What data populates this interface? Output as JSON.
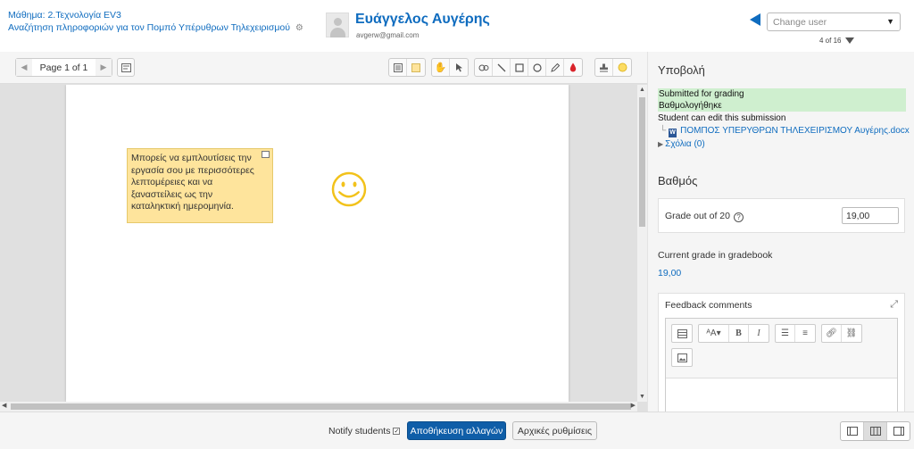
{
  "header": {
    "course_link": "Μάθημα: 2.Τεχνολογία ΕV3",
    "assignment_link": "Αναζήτηση πληροφοριών για τον Πομπό Υπέρυθρων Τηλεχειρισμού",
    "user_name": "Ευάγγελος Αυγέρης",
    "user_email": "avgerw@gmail.com",
    "change_user_placeholder": "Change user",
    "user_count": "4 of 16"
  },
  "viewer": {
    "page_label": "Page 1 of 1",
    "toolbar_icons": [
      "comment-icon",
      "color-swatch-icon",
      "pan-hand-icon",
      "select-arrow-icon",
      "oval-search-icon",
      "line-icon",
      "rectangle-icon",
      "circle-icon",
      "pen-icon",
      "highlighter-icon",
      "stamp-icon",
      "stamp-color-icon"
    ],
    "note_text": "Μπορείς να εμπλουτίσεις την εργασία σου με περισσότερες λεπτομέρειες και να ξαναστείλεις ως την καταληκτική ημερομηνία."
  },
  "submission": {
    "heading": "Υποβολή",
    "status_submitted": "Submitted for grading",
    "status_graded": "Βαθμολογήθηκε",
    "can_edit": "Student can edit this submission",
    "file_name": "ΠΟΜΠΟΣ ΥΠΕΡΥΘΡΩΝ ΤΗΛΕΧΕΙΡΙΣΜΟΥ Αυγέρης.docx",
    "comments_link": "Σχόλια (0)"
  },
  "grade": {
    "heading": "Βαθμός",
    "grade_label": "Grade out of 20",
    "grade_value": "19,00",
    "gradebook_label": "Current grade in gradebook",
    "gradebook_value": "19,00",
    "feedback_label": "Feedback comments"
  },
  "footer": {
    "notify_label": "Notify students",
    "save_label": "Αποθήκευση αλλαγών",
    "reset_label": "Αρχικές ρυθμίσεις"
  },
  "colors": {
    "link": "#0f6cbf",
    "status_bg": "#cfefcf",
    "note_bg": "#fee49c",
    "save_bg": "#0f5ea8"
  }
}
